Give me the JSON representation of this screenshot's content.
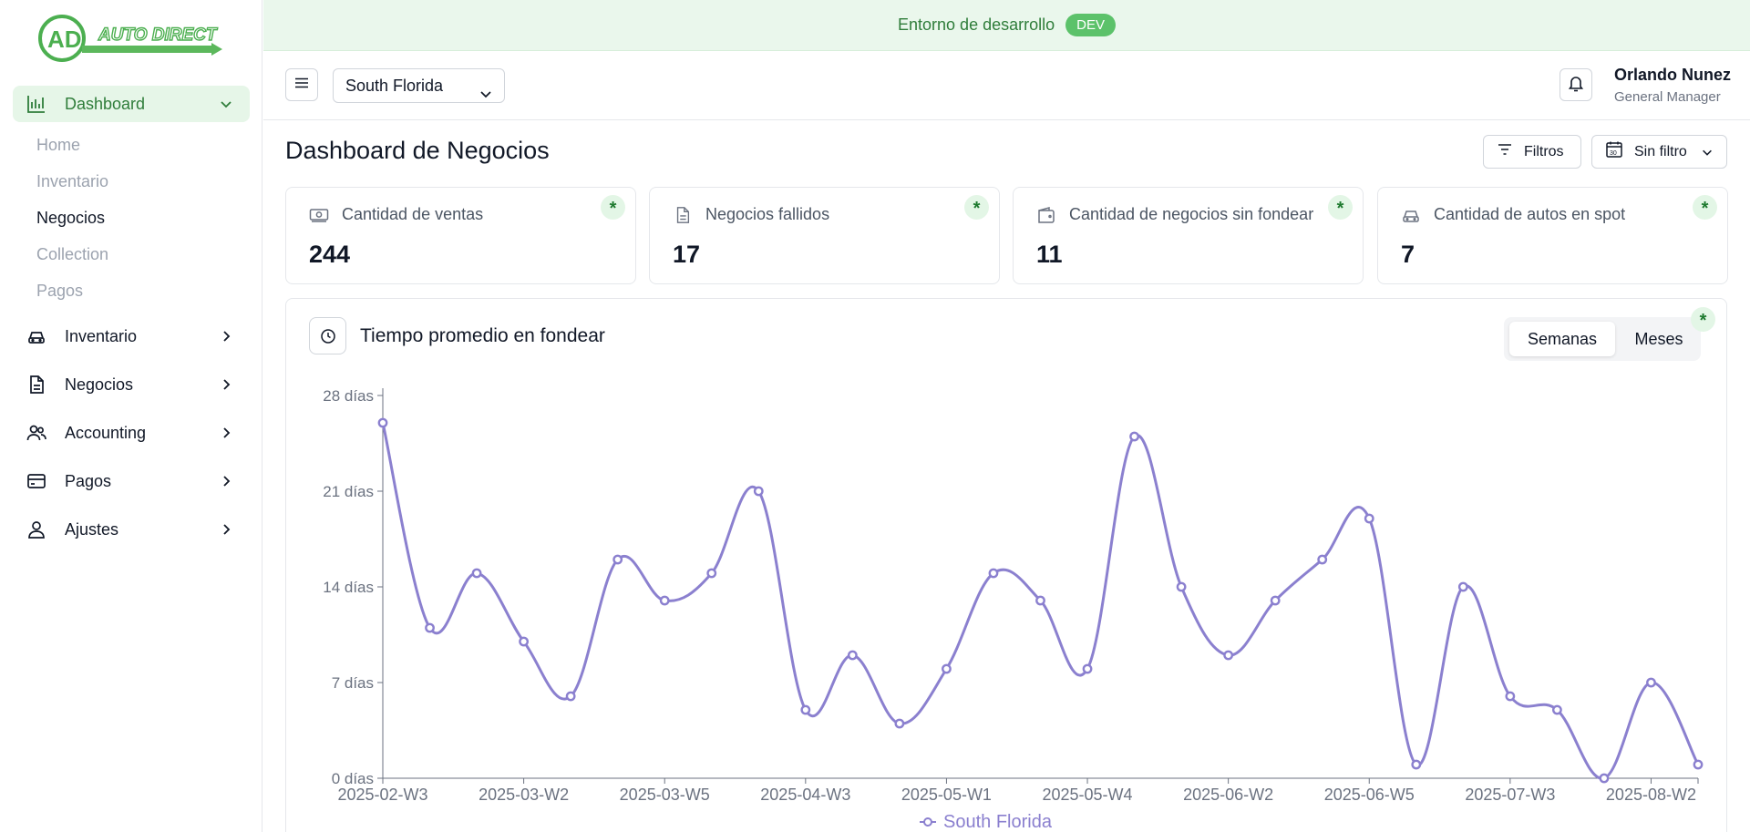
{
  "brand": {
    "logo_text": "AUTO DIRECT",
    "logo_initials": "AD",
    "color": "#4caf50"
  },
  "banner": {
    "text": "Entorno de desarrollo",
    "badge": "DEV"
  },
  "sidebar": {
    "dashboard": {
      "label": "Dashboard",
      "icon": "bar-chart-icon"
    },
    "dashboard_sub": [
      "Home",
      "Inventario",
      "Negocios",
      "Collection",
      "Pagos"
    ],
    "items": [
      {
        "label": "Inventario",
        "icon": "car-icon"
      },
      {
        "label": "Negocios",
        "icon": "document-icon"
      },
      {
        "label": "Accounting",
        "icon": "users-icon"
      },
      {
        "label": "Pagos",
        "icon": "credit-card-icon"
      },
      {
        "label": "Ajustes",
        "icon": "user-icon"
      }
    ]
  },
  "header": {
    "region": "South Florida",
    "user_name": "Orlando Nunez",
    "user_role": "General Manager"
  },
  "page": {
    "title": "Dashboard de Negocios",
    "filters_label": "Filtros",
    "date_filter_label": "Sin filtro"
  },
  "kpis": [
    {
      "label": "Cantidad de ventas",
      "value": "244",
      "icon": "money-icon"
    },
    {
      "label": "Negocios fallidos",
      "value": "17",
      "icon": "file-icon"
    },
    {
      "label": "Cantidad de negocios sin fondear",
      "value": "11",
      "icon": "wallet-icon"
    },
    {
      "label": "Cantidad de autos en spot",
      "value": "7",
      "icon": "car-icon"
    }
  ],
  "star_symbol": "*",
  "chart_panel": {
    "title": "Tiempo promedio en fondear",
    "toggle": {
      "weeks": "Semanas",
      "months": "Meses",
      "selected": "Semanas"
    }
  },
  "chart_data": {
    "type": "line",
    "title": "Tiempo promedio en fondear",
    "y_unit": "días",
    "ylim": [
      0,
      28
    ],
    "y_ticks": [
      0,
      7,
      14,
      21,
      28
    ],
    "y_tick_labels": [
      "0 días",
      "7 días",
      "14 días",
      "21 días",
      "28 días"
    ],
    "x_tick_labels": [
      "2025-02-W3",
      "2025-03-W2",
      "2025-03-W5",
      "2025-04-W3",
      "2025-05-W1",
      "2025-05-W4",
      "2025-06-W2",
      "2025-06-W5",
      "2025-07-W3",
      "2025-08-W2"
    ],
    "x_tick_every": 3,
    "legend_position": "bottom",
    "grid": false,
    "series": [
      {
        "name": "South Florida",
        "color": "#8b80cf",
        "values": [
          26,
          11,
          15,
          10,
          6,
          16,
          13,
          15,
          21,
          5,
          9,
          4,
          8,
          15,
          13,
          8,
          25,
          14,
          9,
          13,
          16,
          19,
          1,
          14,
          6,
          5,
          0,
          7,
          1
        ]
      }
    ]
  }
}
